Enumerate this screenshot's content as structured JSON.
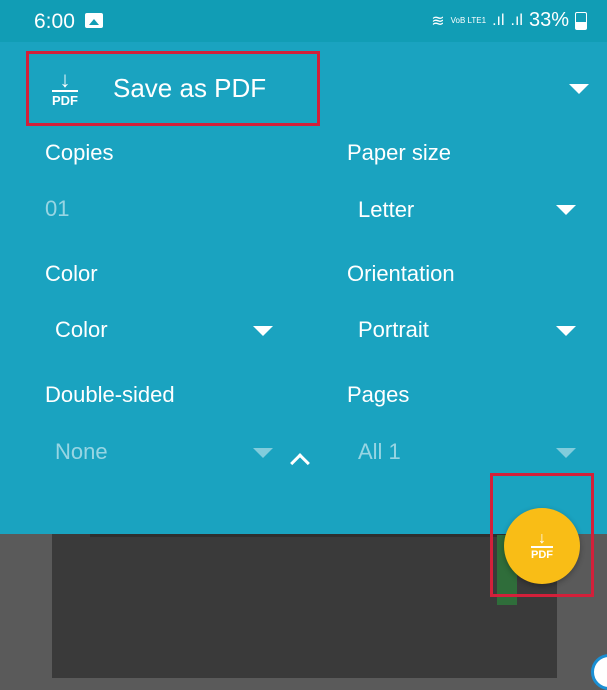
{
  "status_bar": {
    "time": "6:00",
    "network": "VoB LTE1",
    "battery": "33%"
  },
  "printer": {
    "name": "Save as PDF",
    "icon_text": "PDF"
  },
  "options": {
    "copies": {
      "label": "Copies",
      "value": "01"
    },
    "paper_size": {
      "label": "Paper size",
      "value": "Letter"
    },
    "color": {
      "label": "Color",
      "value": "Color"
    },
    "orientation": {
      "label": "Orientation",
      "value": "Portrait"
    },
    "double_sided": {
      "label": "Double-sided",
      "value": "None"
    },
    "pages": {
      "label": "Pages",
      "value": "All 1"
    }
  },
  "fab": {
    "icon_text": "PDF"
  },
  "colors": {
    "panel": "#1aa3c0",
    "fab": "#f9bd16",
    "highlight": "#d3203a"
  }
}
